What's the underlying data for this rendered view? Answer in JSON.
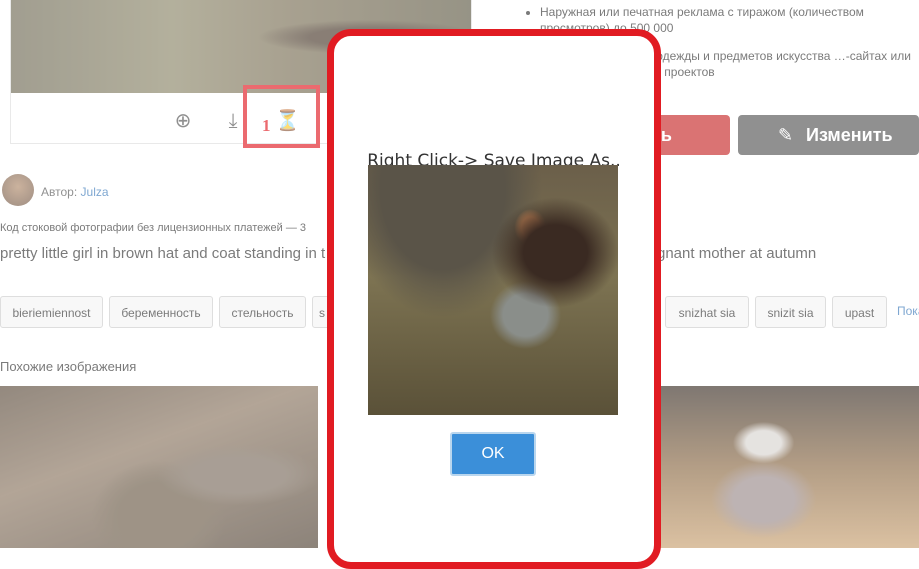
{
  "toolbar": {
    "zoom_icon": "plus-circle-icon",
    "download_icon": "download-icon",
    "save_icon": "arrow-down-circle-icon",
    "highlight_number": "1"
  },
  "license": {
    "items": [
      "Наружная или печатная реклама с тиражом (количеством просмотров) до 500 000",
      "…зводстве товаров, одежды и предметов искусства …-сайтах или в шаблонах печатных проектов"
    ],
    "buy_label": "ить",
    "edit_label": "Изменить"
  },
  "author": {
    "label": "Автор:",
    "name": "Julza"
  },
  "code_line": "Код стоковой фотографии без лицензионных платежей — 3",
  "title_left": "pretty little girl in brown hat and coat standing in t",
  "title_right": "gnant mother at autumn",
  "tags": [
    "bieriemiennost",
    "беременность",
    "стельность",
    "s",
    "snizhat sia",
    "snizit sia",
    "upast"
  ],
  "tags_more": "Пока",
  "similar_heading": "Похожие изображения",
  "modal": {
    "title": "Right Click-> Save Image As..",
    "ok_label": "OK"
  },
  "colors": {
    "highlight": "#e11b22",
    "ok_button": "#3b8fd9",
    "buy_button": "#c62828",
    "edit_button": "#555555"
  }
}
